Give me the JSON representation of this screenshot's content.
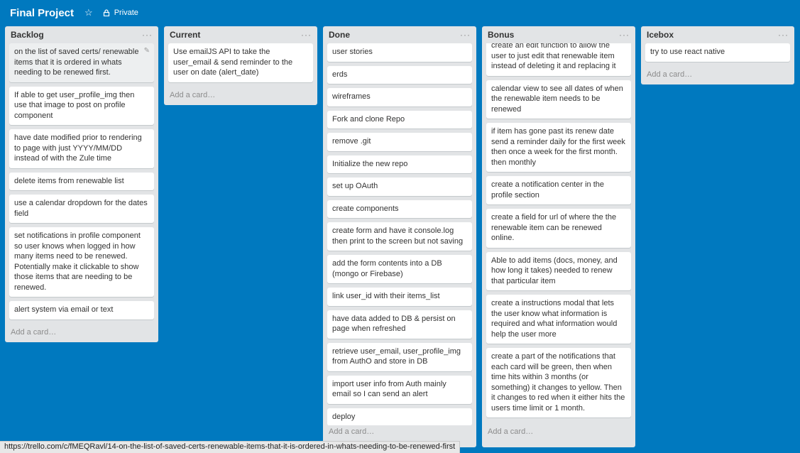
{
  "board": {
    "title": "Final Project",
    "privacy": "Private"
  },
  "lists": {
    "backlog": {
      "title": "Backlog",
      "menu": "···",
      "add_card": "Add a card…",
      "cards": [
        "on the list of saved certs/ renewable items that it is ordered in whats needing to be renewed first.",
        "If able to get user_profile_img then use that image to post on profile component",
        "have date modified prior to rendering to page with just YYYY/MM/DD instead of with the Zule time",
        "delete items from renewable list",
        "use a calendar dropdown for the dates field",
        "set notifications in profile component so user knows when logged in how many items need to be renewed. Potentially make it clickable to show those items that are needing to be renewed.",
        "alert system via email or text"
      ]
    },
    "current": {
      "title": "Current",
      "menu": "···",
      "add_card": "Add a card…",
      "cards": [
        "Use emailJS API to take the user_email & send reminder to the user on date (alert_date)"
      ]
    },
    "done": {
      "title": "Done",
      "menu": "···",
      "add_card": "Add a card…",
      "cards": [
        "user stories",
        "erds",
        "wireframes",
        "Fork and clone Repo",
        "remove .git",
        "Initialize the new repo",
        "set up OAuth",
        "create components",
        "create form and have it console.log then print to the screen but not saving",
        "add the form contents into a DB (mongo or Firebase)",
        "link user_id with their items_list",
        "have data added to DB & persist on page when refreshed",
        "retrieve user_email, user_profile_img from AuthO and store in DB",
        "import user info from Auth mainly email so I can send an alert",
        "deploy"
      ]
    },
    "bonus": {
      "title": "Bonus",
      "menu": "···",
      "add_card": "Add a card…",
      "cards": [
        "create an edit function to allow the user to just edit that renewable item instead of deleting it and replacing it",
        "calendar view to see all dates of when the renewable item needs to be renewed",
        "if item has gone past its renew date send a reminder daily for the first week then once a week for the first month. then monthly",
        "create a notification center in the profile section",
        "create a field for url of where the the renewable item can be renewed online.",
        "Able to add items (docs, money, and how long it takes) needed to renew that particular item",
        "create a instructions modal that lets the user know what information is required and what information would help the user more",
        "create a part of the notifications that each card will be green, then when time hits within 3 months (or something) it changes to yellow. Then it changes to red when it either hits the users time limit or 1 month."
      ]
    },
    "icebox": {
      "title": "Icebox",
      "menu": "···",
      "add_card": "Add a card…",
      "cards": [
        "try to use react native"
      ]
    }
  },
  "status_url": "https://trello.com/c/fMEQRavl/14-on-the-list-of-saved-certs-renewable-items-that-it-is-ordered-in-whats-needing-to-be-renewed-first",
  "icons": {
    "star": "star-icon",
    "lock": "lock-icon",
    "edit": "pencil-icon"
  },
  "colors": {
    "board_bg": "#0079bf",
    "list_bg": "#e2e4e6"
  }
}
